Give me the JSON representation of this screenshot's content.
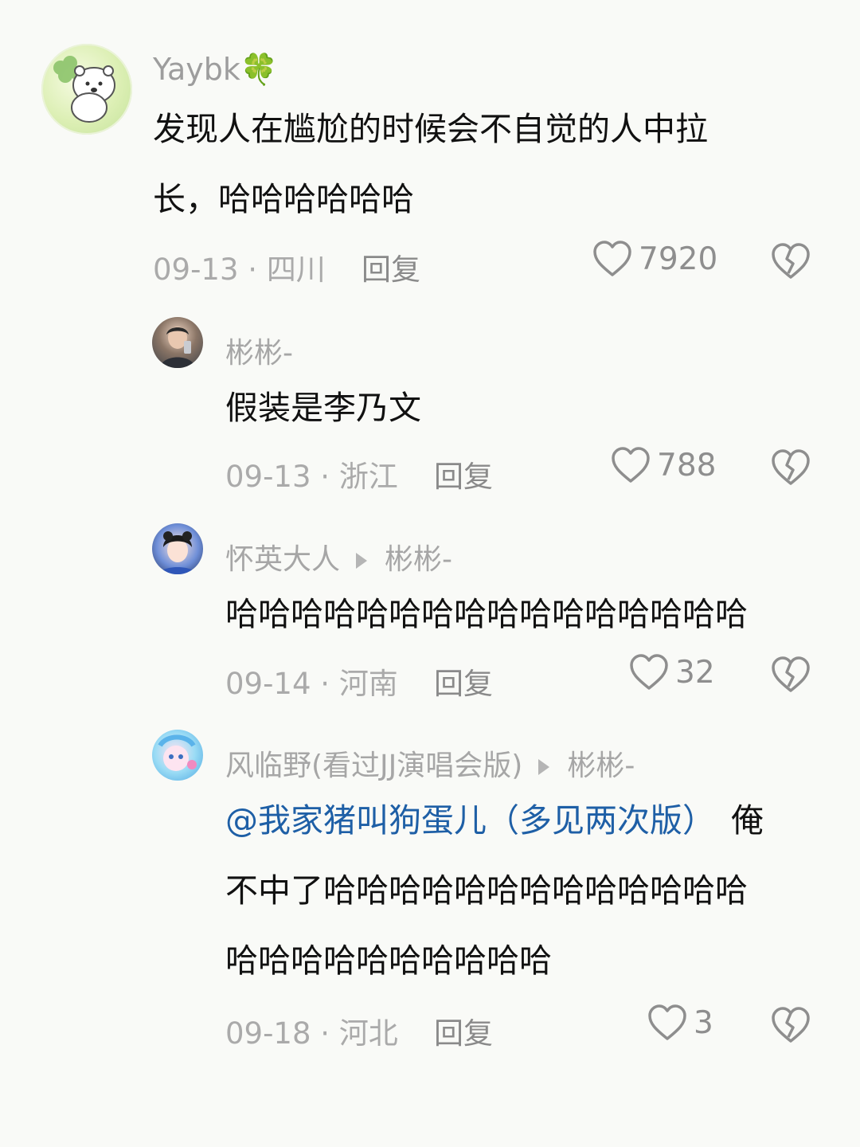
{
  "comments": [
    {
      "username": "Yaybk",
      "username_emoji": "🍀",
      "text_lines": [
        "发现人在尴尬的时候会不自觉的人中拉",
        "长，哈哈哈哈哈哈"
      ],
      "date": "09-13",
      "location": "四川",
      "reply_label": "回复",
      "likes": "7920"
    },
    {
      "username": "彬彬-",
      "text_lines": [
        "假装是李乃文"
      ],
      "date": "09-13",
      "location": "浙江",
      "reply_label": "回复",
      "likes": "788"
    },
    {
      "username": "怀英大人",
      "reply_to": "彬彬-",
      "text_lines": [
        "哈哈哈哈哈哈哈哈哈哈哈哈哈哈哈哈"
      ],
      "date": "09-14",
      "location": "河南",
      "reply_label": "回复",
      "likes": "32"
    },
    {
      "username": "风临野(看过JJ演唱会版)",
      "reply_to": "彬彬-",
      "mention": "@我家猪叫狗蛋儿（多见两次版）",
      "text_line1_tail": "俺",
      "text_lines": [
        "不中了哈哈哈哈哈哈哈哈哈哈哈哈哈",
        "哈哈哈哈哈哈哈哈哈哈"
      ],
      "date": "09-18",
      "location": "河北",
      "reply_label": "回复",
      "likes": "3"
    }
  ],
  "separator": " · ",
  "icons": {
    "like": "heart-outline-icon",
    "dislike": "broken-heart-icon"
  }
}
